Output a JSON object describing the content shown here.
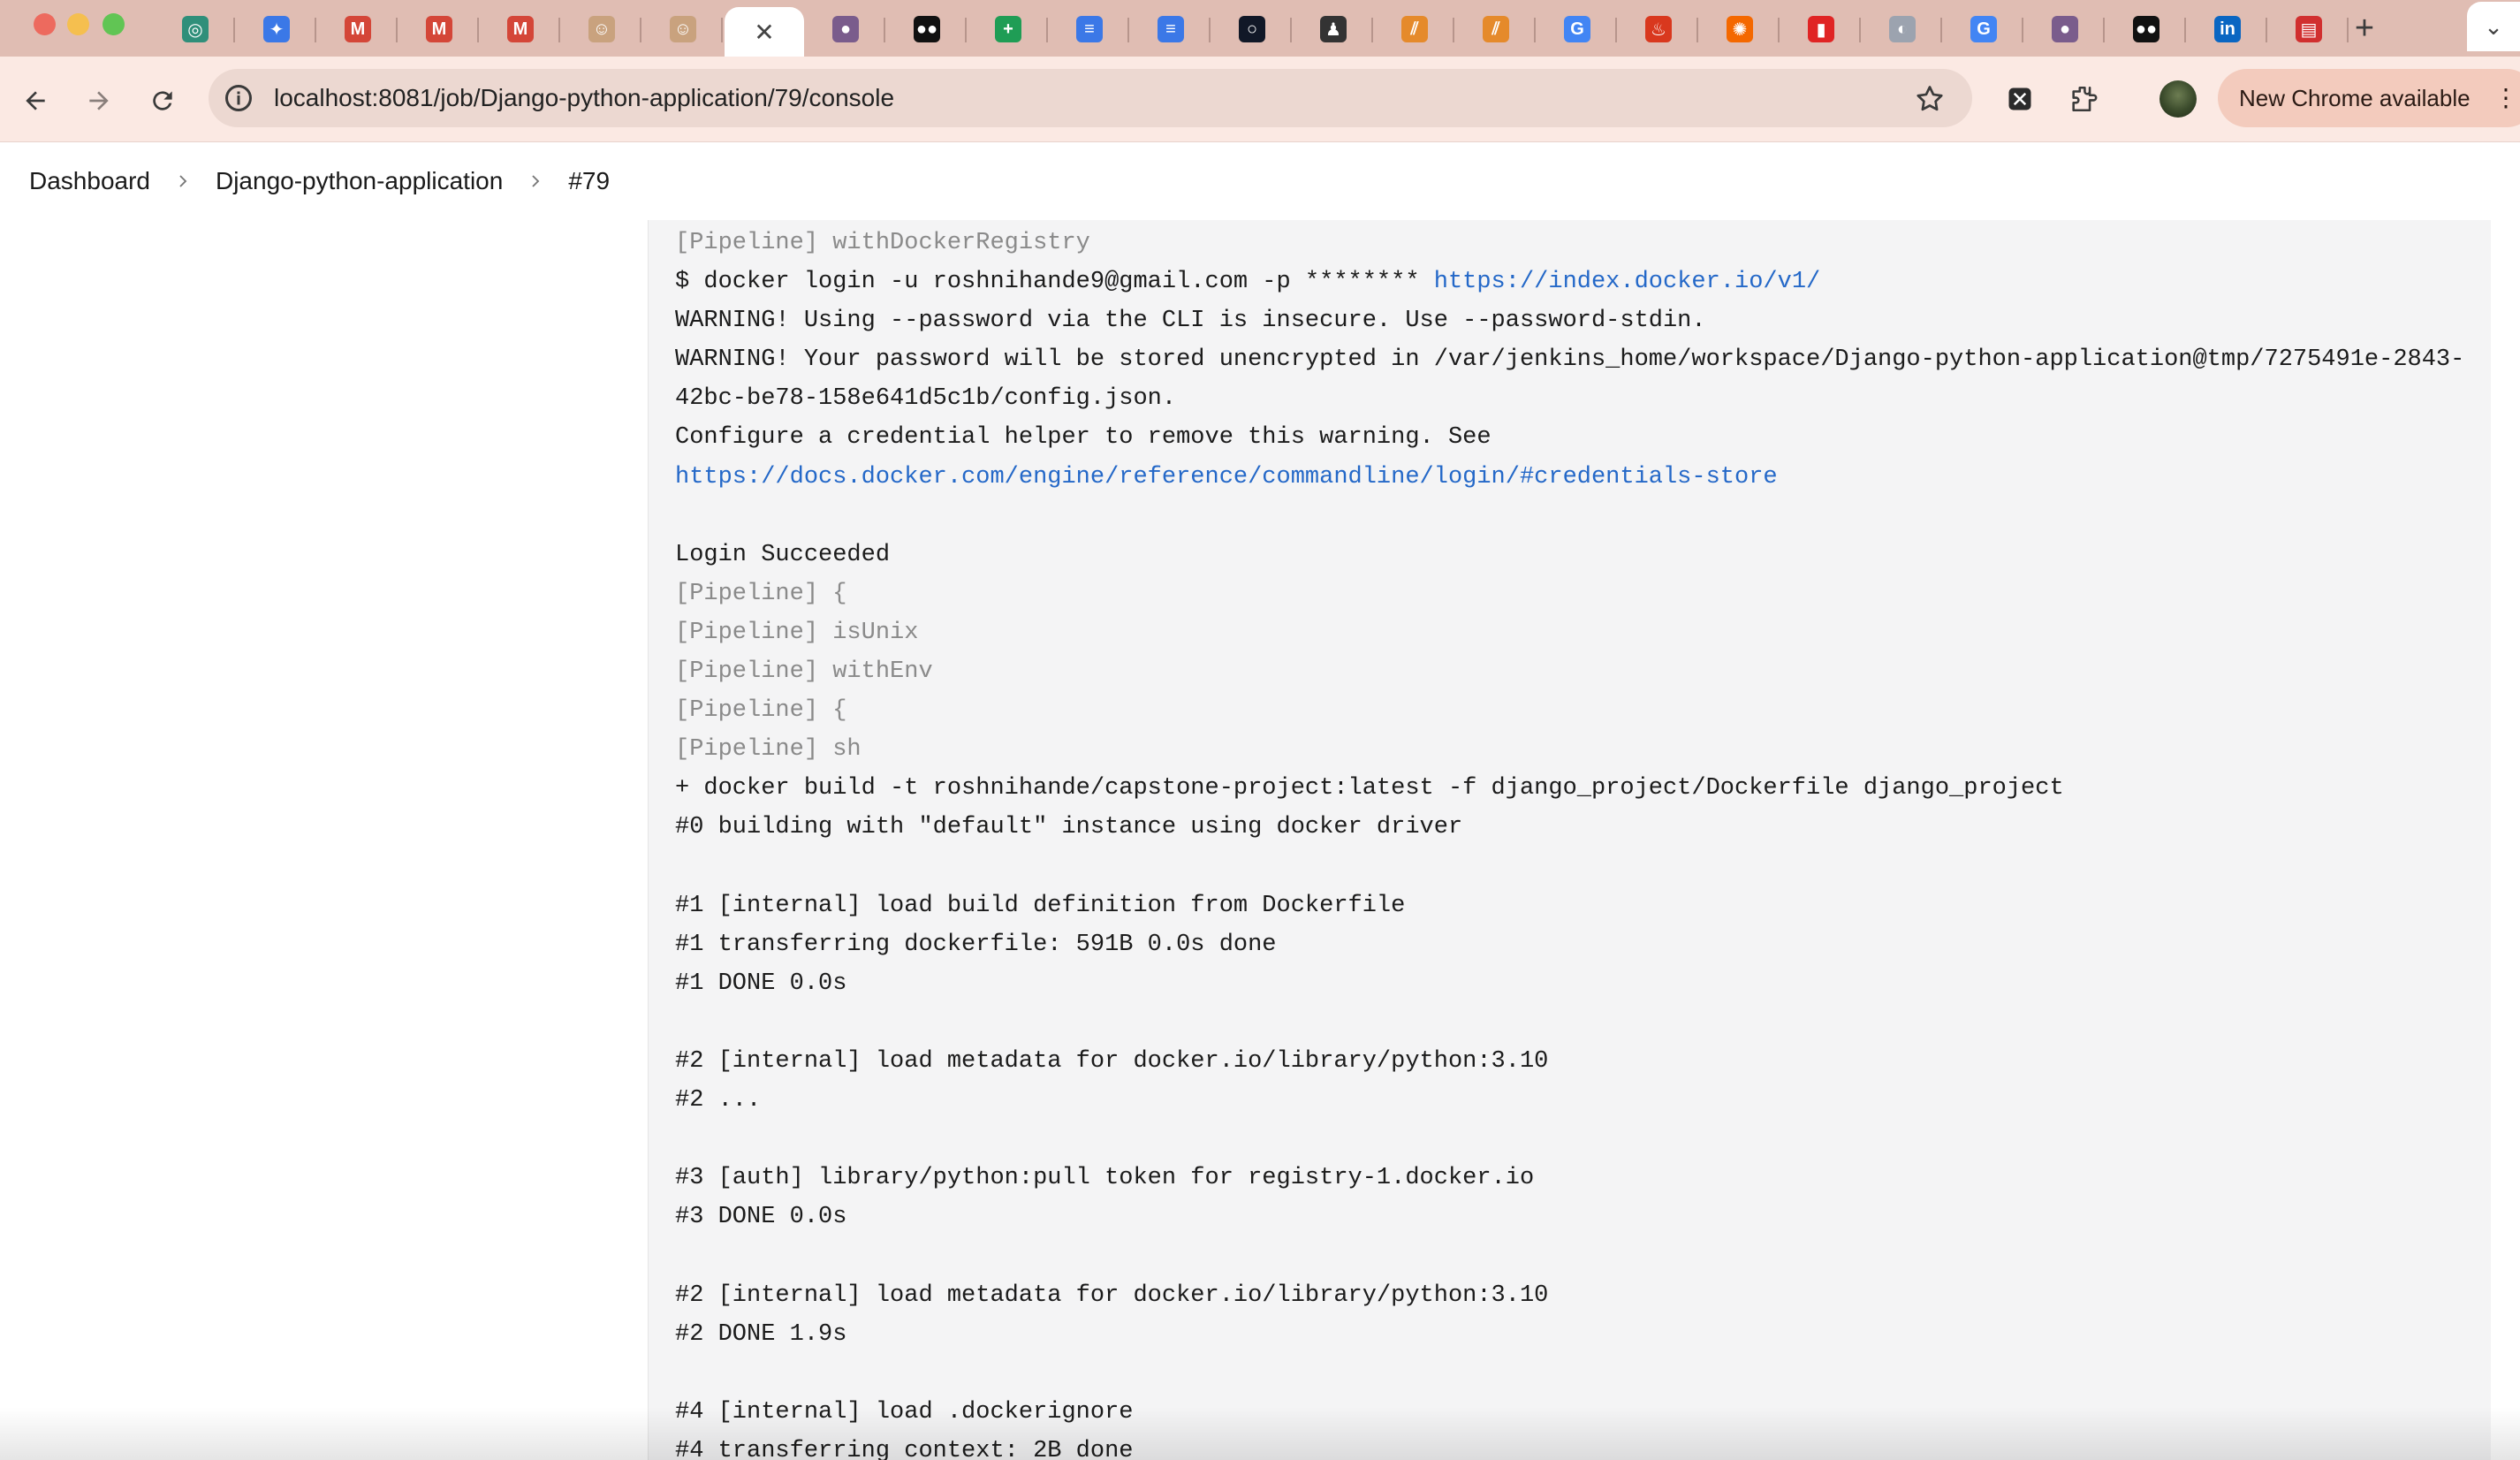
{
  "browser": {
    "tabs": [
      {
        "icon": "chatgpt-icon",
        "color": "#2f8f7a",
        "glyph": "◎"
      },
      {
        "icon": "gemini-icon",
        "color": "#3b78e7",
        "glyph": "✦"
      },
      {
        "icon": "gmail-icon",
        "color": "#d44638",
        "glyph": "M"
      },
      {
        "icon": "gmail-icon",
        "color": "#d44638",
        "glyph": "M"
      },
      {
        "icon": "gmail-icon",
        "color": "#d44638",
        "glyph": "M"
      },
      {
        "icon": "jenkins-icon",
        "color": "#c9a27e",
        "glyph": "☺"
      },
      {
        "icon": "jenkins-icon",
        "color": "#c9a27e",
        "glyph": "☺"
      },
      {
        "icon": "close-icon",
        "color": "#444444",
        "glyph": "✕",
        "active": true
      },
      {
        "icon": "github-icon",
        "color": "#7a5c8c",
        "glyph": "●"
      },
      {
        "icon": "medium-icon",
        "color": "#111111",
        "glyph": "●●"
      },
      {
        "icon": "sheets-icon",
        "color": "#1f9d55",
        "glyph": "+"
      },
      {
        "icon": "docs-icon",
        "color": "#3b78e7",
        "glyph": "≡"
      },
      {
        "icon": "docs-icon",
        "color": "#3b78e7",
        "glyph": "≡"
      },
      {
        "icon": "ring-icon",
        "color": "#111827",
        "glyph": "○"
      },
      {
        "icon": "person-icon",
        "color": "#333333",
        "glyph": "♟"
      },
      {
        "icon": "stack-icon",
        "color": "#e58a2b",
        "glyph": "⫽"
      },
      {
        "icon": "stack-icon",
        "color": "#e58a2b",
        "glyph": "⫽"
      },
      {
        "icon": "google-icon",
        "color": "#4285f4",
        "glyph": "G"
      },
      {
        "icon": "fire-icon",
        "color": "#d9381e",
        "glyph": "♨"
      },
      {
        "icon": "grafana-icon",
        "color": "#f46800",
        "glyph": "✺"
      },
      {
        "icon": "bookmark-icon",
        "color": "#e02424",
        "glyph": "▮"
      },
      {
        "icon": "globe-icon",
        "color": "#9ca3af",
        "glyph": "◐"
      },
      {
        "icon": "google-icon",
        "color": "#4285f4",
        "glyph": "G"
      },
      {
        "icon": "github-icon",
        "color": "#7a5c8c",
        "glyph": "●"
      },
      {
        "icon": "medium-icon",
        "color": "#111111",
        "glyph": "●●"
      },
      {
        "icon": "linkedin-icon",
        "color": "#0a66c2",
        "glyph": "in"
      },
      {
        "icon": "pdf-icon",
        "color": "#d12f2f",
        "glyph": "▤"
      }
    ],
    "url": "localhost:8081/job/Django-python-application/79/console",
    "update_label": "New Chrome available"
  },
  "breadcrumb": [
    "Dashboard",
    "Django-python-application",
    "#79"
  ],
  "console": {
    "lines": [
      {
        "t": "[Pipeline] withDockerRegistry",
        "kind": "pipe"
      },
      {
        "t": "$ docker login -u roshnihande9@gmail.com -p ******** ",
        "link": "https://index.docker.io/v1/"
      },
      {
        "t": "WARNING! Using --password via the CLI is insecure. Use --password-stdin."
      },
      {
        "t": "WARNING! Your password will be stored unencrypted in /var/jenkins_home/workspace/Django-python-application@tmp/7275491e-2843-"
      },
      {
        "t": "42bc-be78-158e641d5c1b/config.json."
      },
      {
        "t": "Configure a credential helper to remove this warning. See"
      },
      {
        "t": "",
        "link": "https://docs.docker.com/engine/reference/commandline/login/#credentials-store"
      },
      {
        "t": ""
      },
      {
        "t": "Login Succeeded"
      },
      {
        "t": "[Pipeline] {",
        "kind": "pipe"
      },
      {
        "t": "[Pipeline] isUnix",
        "kind": "pipe"
      },
      {
        "t": "[Pipeline] withEnv",
        "kind": "pipe"
      },
      {
        "t": "[Pipeline] {",
        "kind": "pipe"
      },
      {
        "t": "[Pipeline] sh",
        "kind": "pipe"
      },
      {
        "t": "+ docker build -t roshnihande/capstone-project:latest -f django_project/Dockerfile django_project"
      },
      {
        "t": "#0 building with \"default\" instance using docker driver"
      },
      {
        "t": ""
      },
      {
        "t": "#1 [internal] load build definition from Dockerfile"
      },
      {
        "t": "#1 transferring dockerfile: 591B 0.0s done"
      },
      {
        "t": "#1 DONE 0.0s"
      },
      {
        "t": ""
      },
      {
        "t": "#2 [internal] load metadata for docker.io/library/python:3.10"
      },
      {
        "t": "#2 ..."
      },
      {
        "t": ""
      },
      {
        "t": "#3 [auth] library/python:pull token for registry-1.docker.io"
      },
      {
        "t": "#3 DONE 0.0s"
      },
      {
        "t": ""
      },
      {
        "t": "#2 [internal] load metadata for docker.io/library/python:3.10"
      },
      {
        "t": "#2 DONE 1.9s"
      },
      {
        "t": ""
      },
      {
        "t": "#4 [internal] load .dockerignore"
      },
      {
        "t": "#4 transferring context: 2B done"
      }
    ]
  }
}
